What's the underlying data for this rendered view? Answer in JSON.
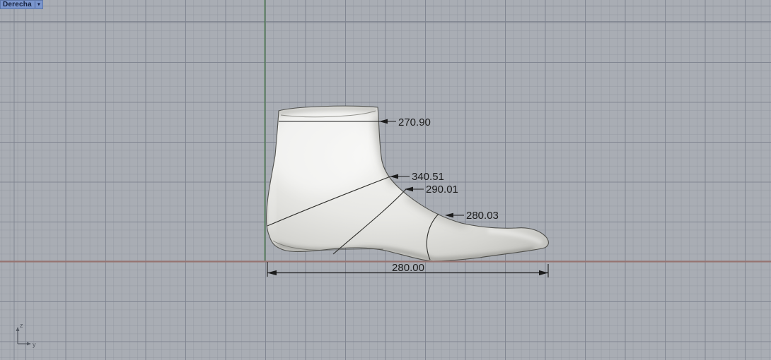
{
  "viewport": {
    "title": "Derecha",
    "dropdown_icon": "▾"
  },
  "dimensions": {
    "top_line_girth": "270.90",
    "instep_girth": "340.51",
    "waist_girth": "290.01",
    "toe_girth": "280.03",
    "overall_length": "280.00"
  },
  "axis_indicator": {
    "up_axis": "z",
    "right_axis": "y"
  },
  "colors": {
    "viewport_background": "#a9adb4",
    "grid_minor": "#a0a4ac",
    "grid_major": "#8d919a",
    "vertical_axis_line": "#4e7b51",
    "ground_axis_line": "#967471",
    "annotation_text": "#1c1c1c",
    "tab_background": "#7b96cd",
    "tab_text": "#16213d",
    "model_surface": "#e9e9e6"
  }
}
